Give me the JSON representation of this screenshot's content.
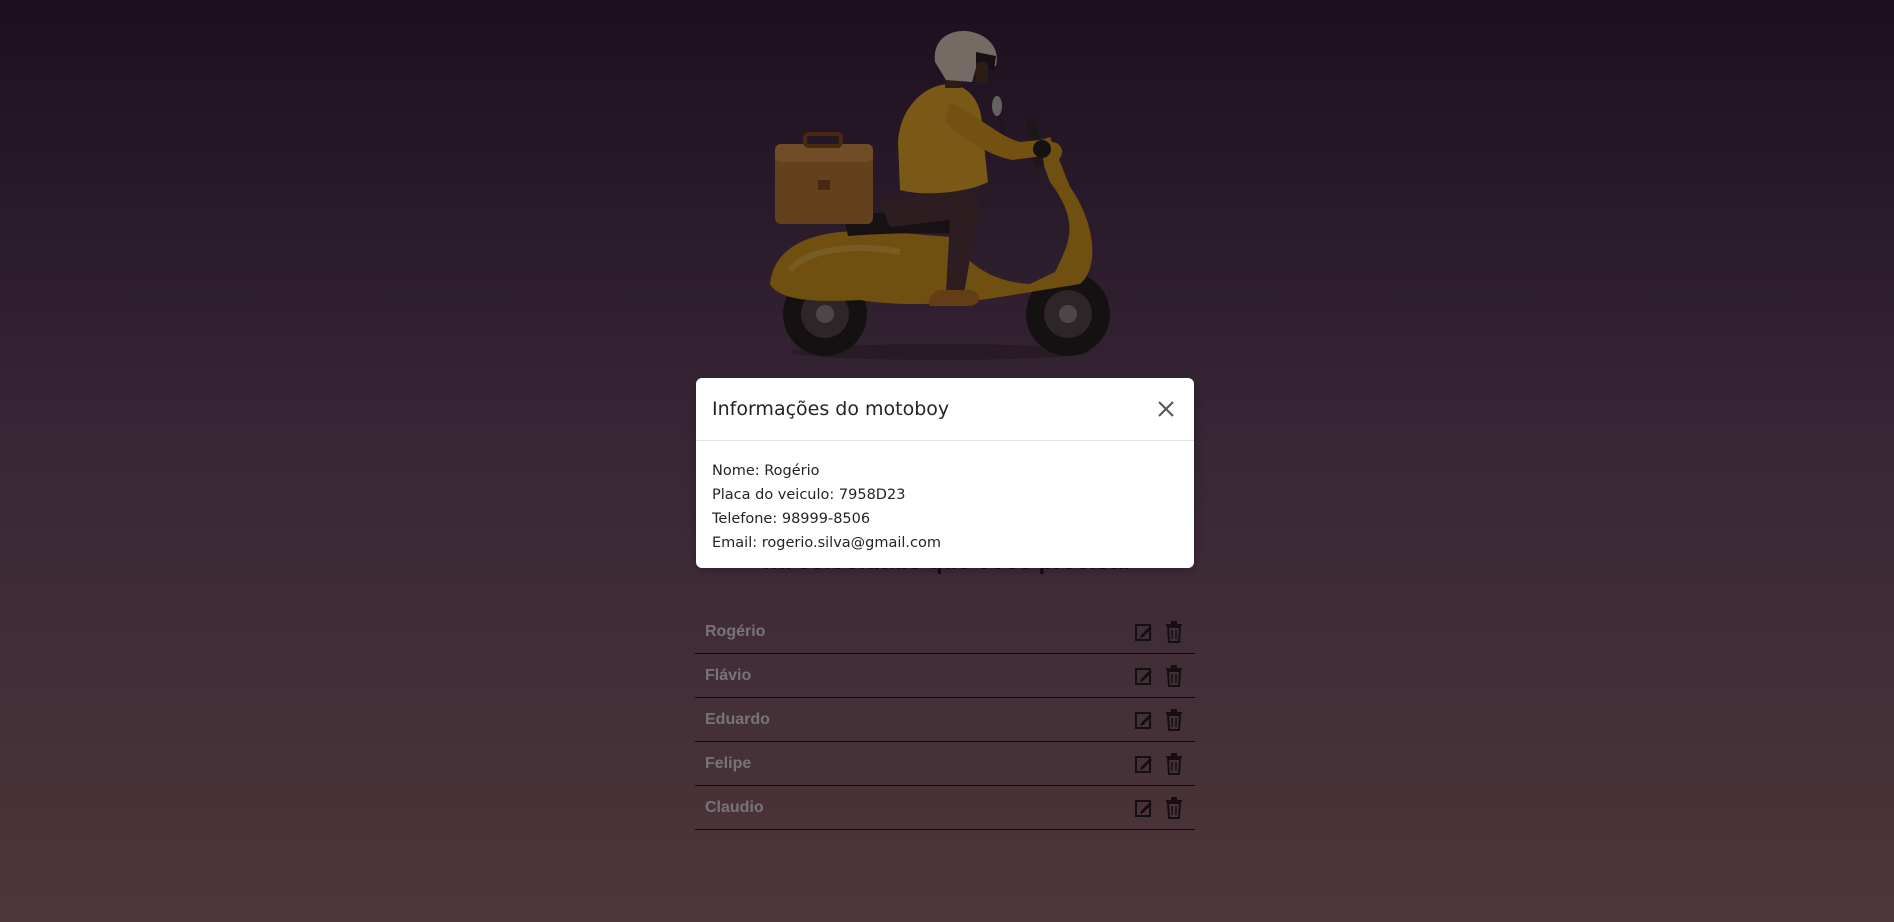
{
  "page": {
    "tagline": "na velocidade que você precisa.",
    "motoboys": [
      {
        "name": "Rogério"
      },
      {
        "name": "Flávio"
      },
      {
        "name": "Eduardo"
      },
      {
        "name": "Felipe"
      },
      {
        "name": "Claudio"
      }
    ]
  },
  "modal": {
    "title": "Informações do motoboy",
    "lines": [
      "Nome: Rogério",
      "Placa do veiculo: 7958D23",
      "Telefone: 98999-8506",
      "Email: rogerio.silva@gmail.com"
    ]
  },
  "icons": {
    "close": "close-icon",
    "edit": "edit-icon",
    "delete": "trash-icon"
  },
  "colors": {
    "scooter": "#e0a020",
    "jacket": "#f2b22a",
    "overlay": "#000000"
  }
}
